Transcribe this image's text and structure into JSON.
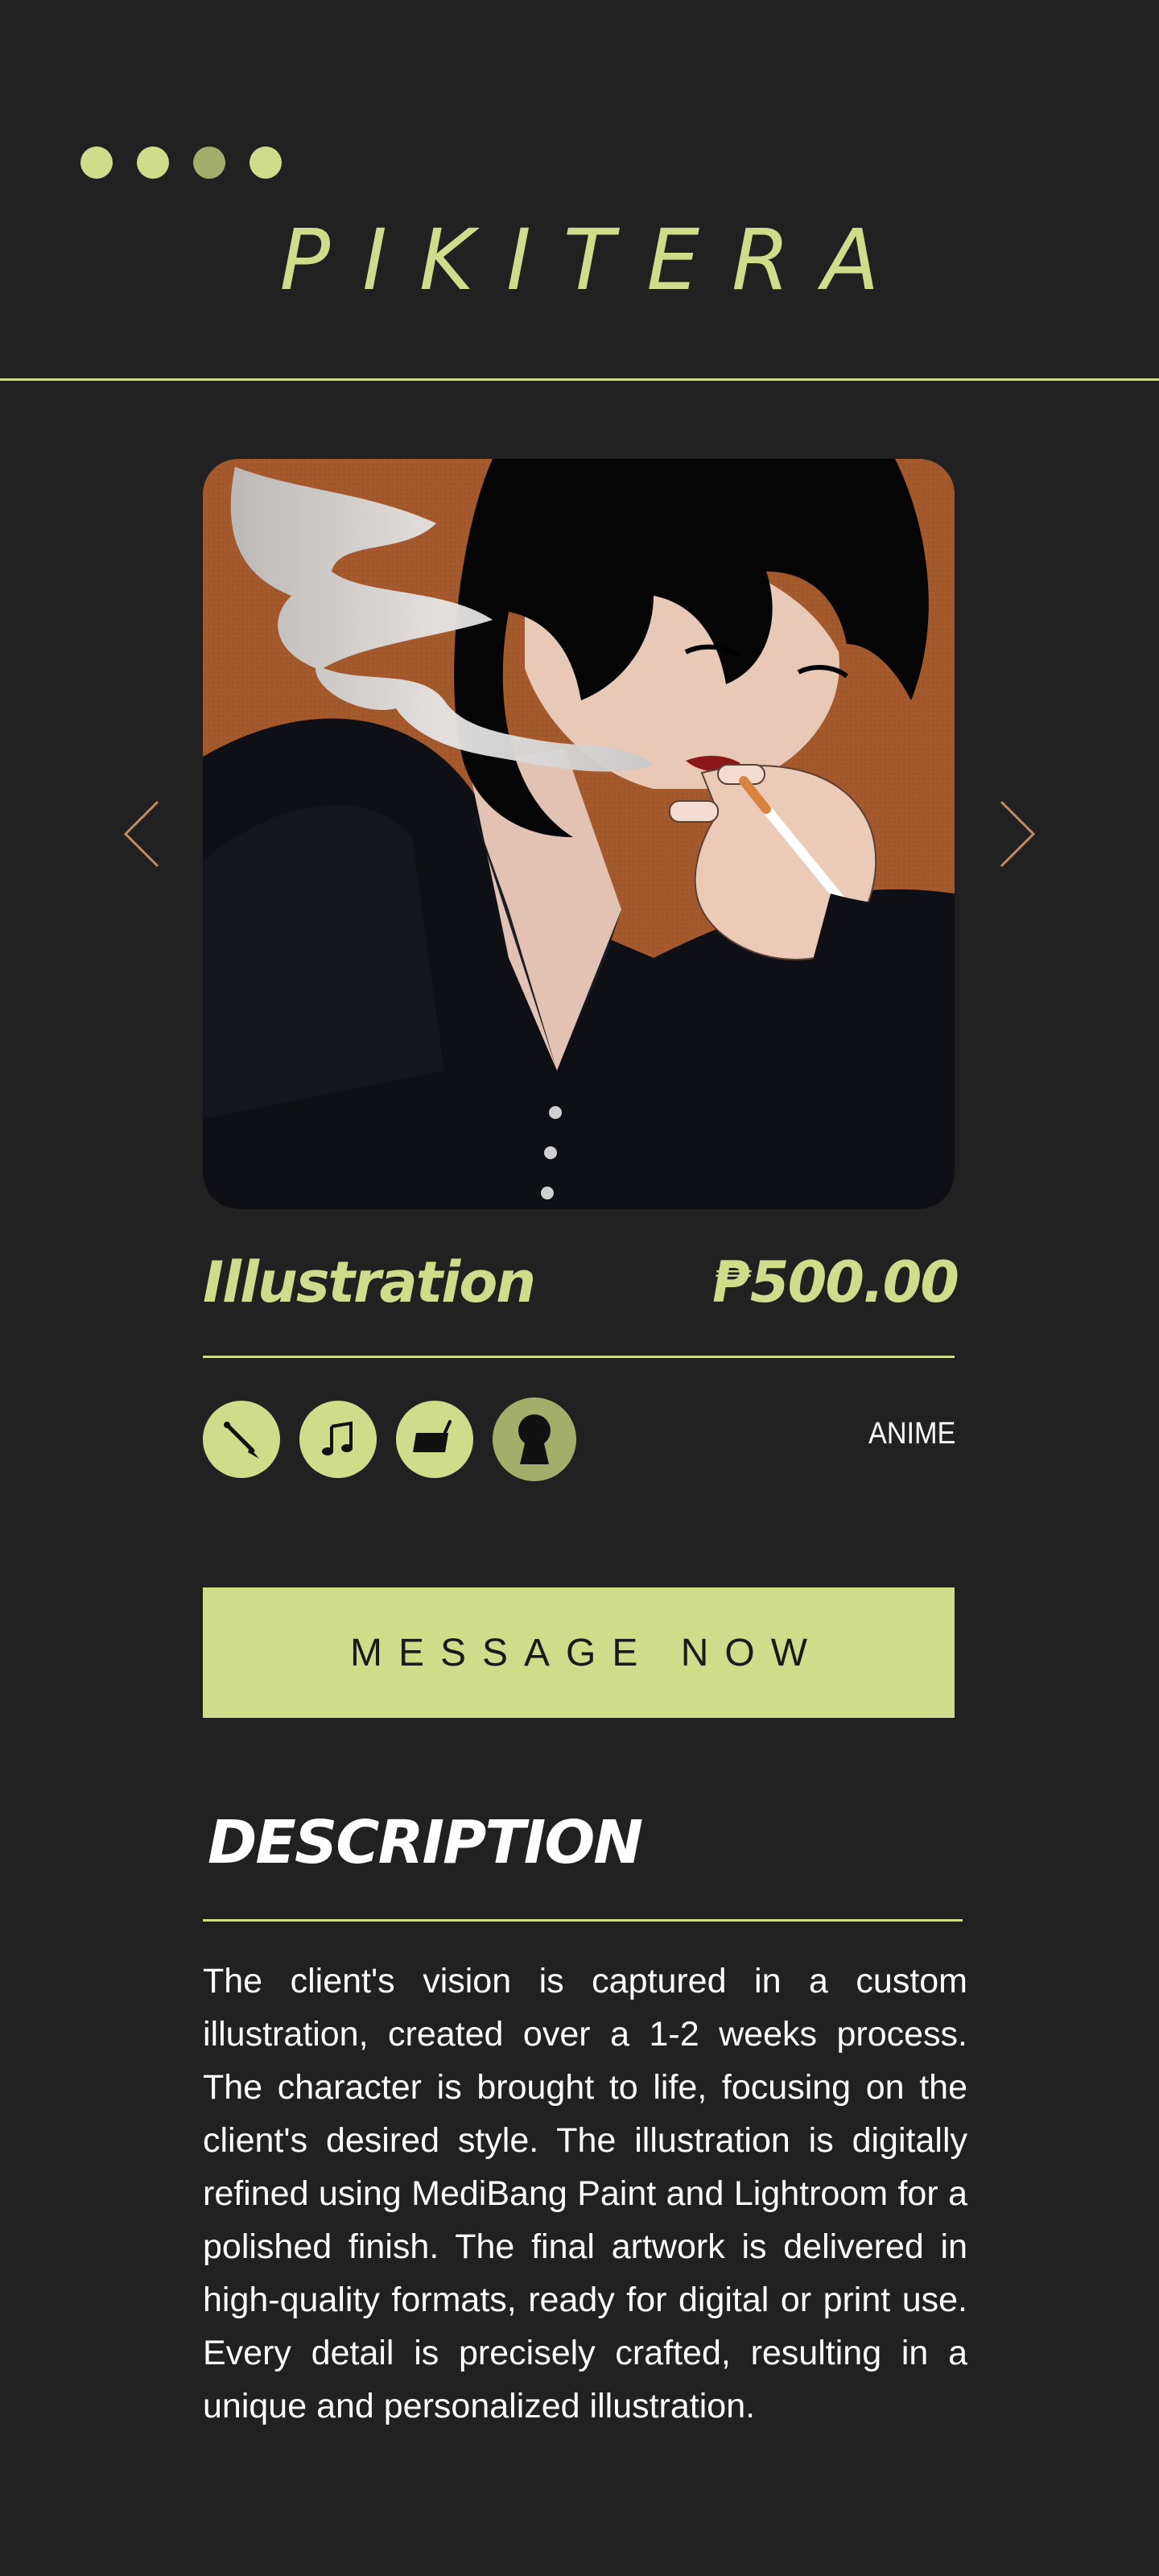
{
  "header": {
    "brand": "PIKITERA",
    "carousel_dots": [
      {
        "active": false
      },
      {
        "active": false
      },
      {
        "active": true
      },
      {
        "active": false
      }
    ]
  },
  "product": {
    "title": "Illustration",
    "price": "₱500.00",
    "genre": "ANIME",
    "feature_icons": [
      "paintbrush-icon",
      "music-note-icon",
      "drawing-tablet-icon",
      "person-icon"
    ]
  },
  "cta": {
    "label": "MESSAGE NOW"
  },
  "description": {
    "heading": "DESCRIPTION",
    "body": "The client's vision is captured in a custom illustration, created over a 1-2 weeks process. The character is brought to life, focusing on the client's desired style. The illustration is digitally refined using MediBang Paint and Lightroom for a polished finish. The final artwork is delivered in high-quality formats, ready for digital or print use. Every detail is precisely crafted, resulting in a unique and personalized illustration."
  },
  "colors": {
    "background": "#212121",
    "accent": "#cfdd8a",
    "accent_dim": "#a3ae6b",
    "arrow": "#c28a62",
    "artwork_bg": "#a55a2c"
  }
}
